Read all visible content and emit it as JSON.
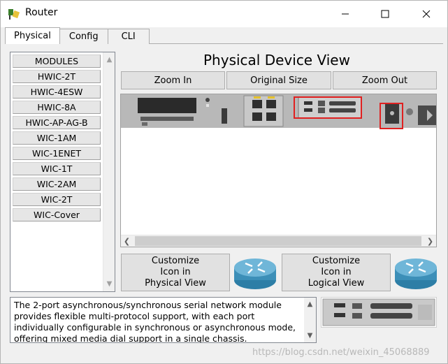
{
  "window": {
    "title": "Router"
  },
  "tabs": [
    {
      "label": "Physical",
      "active": true
    },
    {
      "label": "Config",
      "active": false
    },
    {
      "label": "CLI",
      "active": false
    }
  ],
  "modules": {
    "items": [
      "MODULES",
      "HWIC-2T",
      "HWIC-4ESW",
      "HWIC-8A",
      "HWIC-AP-AG-B",
      "WIC-1AM",
      "WIC-1ENET",
      "WIC-1T",
      "WIC-2AM",
      "WIC-2T",
      "WIC-Cover"
    ]
  },
  "main": {
    "title": "Physical Device View",
    "zoom_in": "Zoom In",
    "original_size": "Original Size",
    "zoom_out": "Zoom Out"
  },
  "customize": {
    "physical": [
      "Customize",
      "Icon in",
      "Physical View"
    ],
    "logical": [
      "Customize",
      "Icon in",
      "Logical View"
    ]
  },
  "description": "The 2-port asynchronous/synchronous serial network module provides flexible multi-protocol support, with each port individually configurable in synchronous or asynchronous mode, offering mixed media dial support in a single chassis.",
  "watermark": "https://blog.csdn.net/weixin_45068889",
  "colors": {
    "highlight": "#e02020",
    "router_blue": "#3c8fb8",
    "power_green": "#2aa52a"
  }
}
